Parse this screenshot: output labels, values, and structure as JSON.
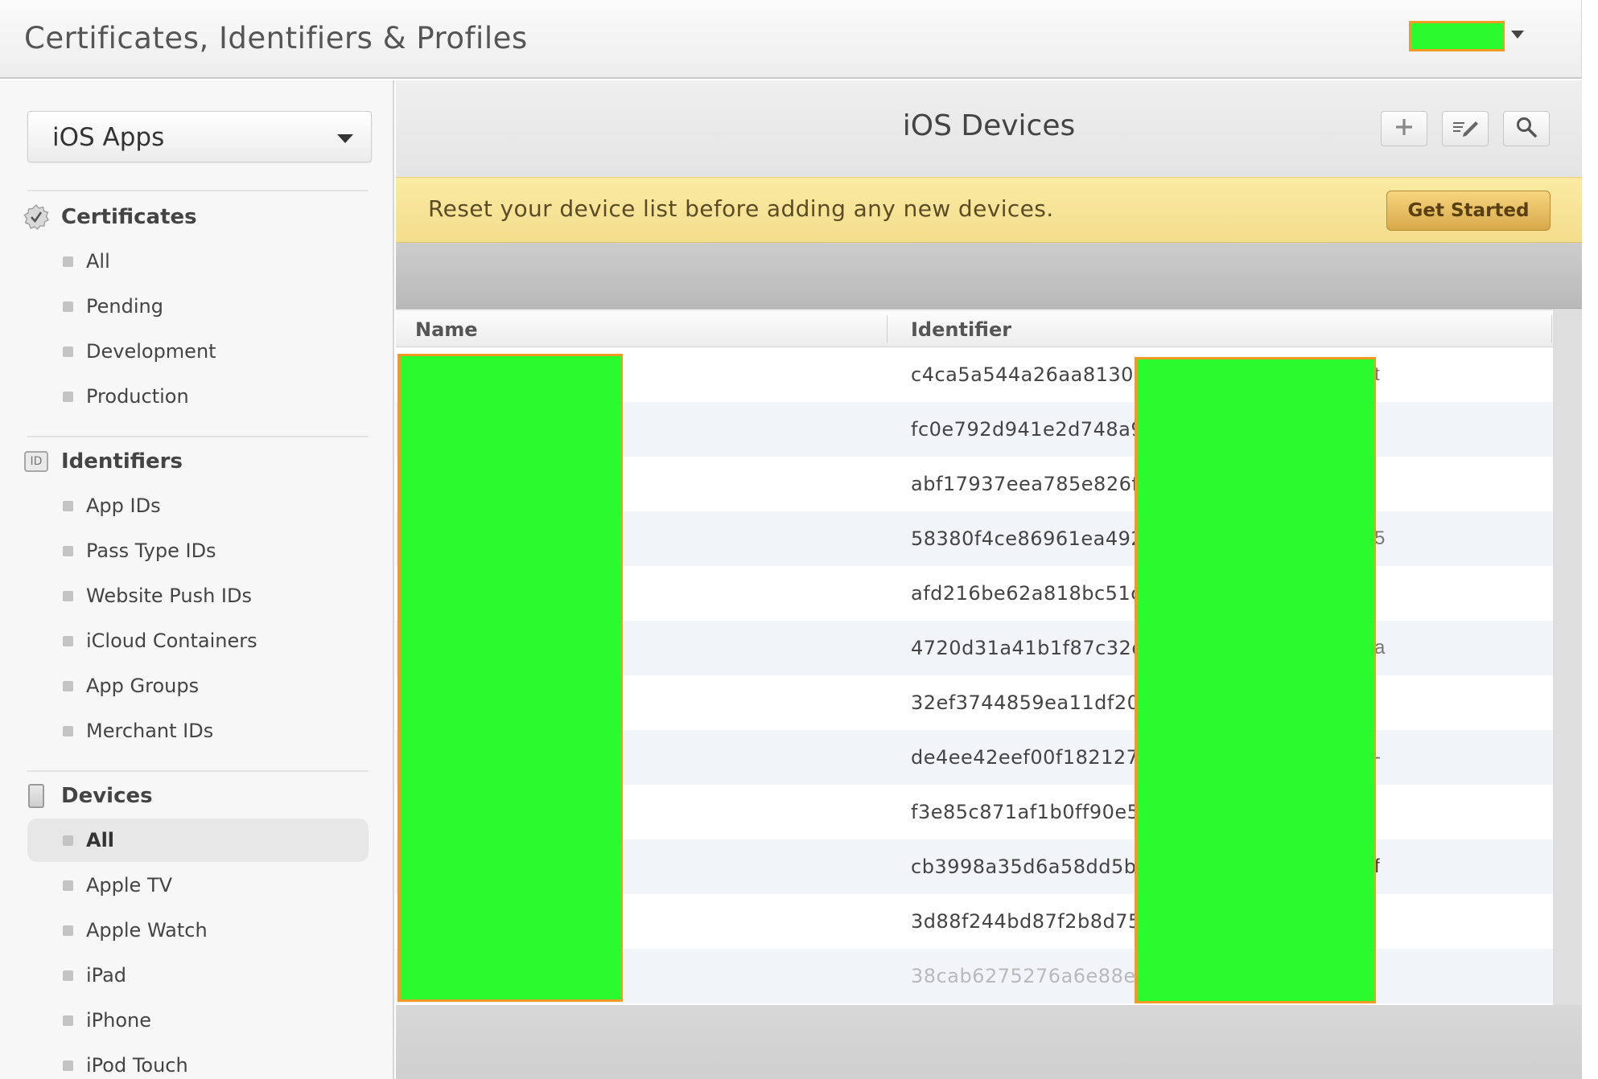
{
  "header": {
    "title": "Certificates, Identifiers & Profiles",
    "account_caret_icon": "caret-down-icon"
  },
  "sidebar": {
    "platform_select": "iOS Apps",
    "sections": {
      "certificates": {
        "title": "Certificates",
        "icon": "certificate-badge-icon",
        "items": [
          "All",
          "Pending",
          "Development",
          "Production"
        ]
      },
      "identifiers": {
        "title": "Identifiers",
        "icon": "id-badge-icon",
        "badge": "ID",
        "items": [
          "App IDs",
          "Pass Type IDs",
          "Website Push IDs",
          "iCloud Containers",
          "App Groups",
          "Merchant IDs"
        ]
      },
      "devices": {
        "title": "Devices",
        "icon": "device-icon",
        "items": [
          "All",
          "Apple TV",
          "Apple Watch",
          "iPad",
          "iPhone",
          "iPod Touch"
        ],
        "active_index": 0
      }
    }
  },
  "main": {
    "title": "iOS Devices",
    "toolbar": {
      "add_icon": "plus-icon",
      "edit_icon": "edit-icon",
      "search_icon": "search-icon"
    },
    "banner": {
      "message": "Reset your device list before adding any new devices.",
      "button": "Get Started",
      "color": "#f7e499"
    },
    "table": {
      "columns": [
        "Name",
        "Identifier"
      ],
      "rows": [
        {
          "identifier": "c4ca5a544a26aa81301"
        },
        {
          "identifier": "fc0e792d941e2d748a9"
        },
        {
          "identifier": "abf17937eea785e826f9"
        },
        {
          "identifier": "58380f4ce86961ea492"
        },
        {
          "identifier": "afd216be62a818bc51c"
        },
        {
          "identifier": "4720d31a41b1f87c32d"
        },
        {
          "identifier": "32ef3744859ea11df202"
        },
        {
          "identifier": "de4ee42eef00f1821279"
        },
        {
          "identifier": "f3e85c871af1b0ff90e5c"
        },
        {
          "identifier": "cb3998a35d6a58dd5b2"
        },
        {
          "identifier": "3d88f244bd87f2b8d75"
        },
        {
          "identifier": "38cab6275276a6e88eb"
        }
      ],
      "trailing_fragments": [
        "t",
        "",
        "",
        "5",
        "",
        "a",
        "",
        "-",
        "",
        "f",
        "",
        ""
      ]
    },
    "redaction_color": "#2bfa2f",
    "redaction_border": "#f39a25"
  }
}
